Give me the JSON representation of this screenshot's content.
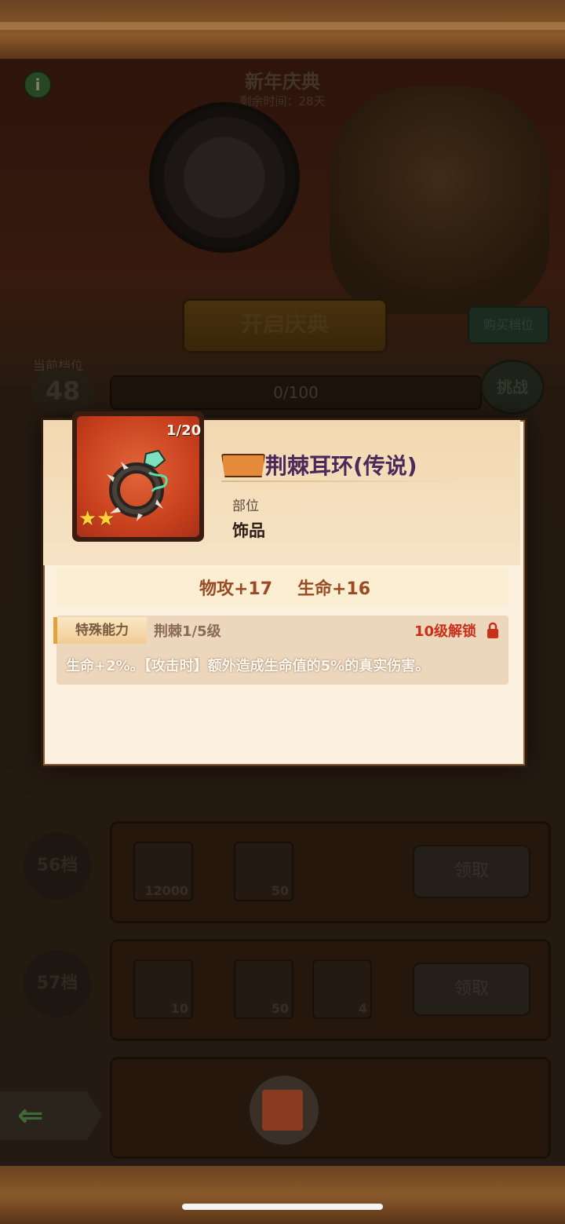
{
  "event": {
    "title": "新年庆典",
    "remaining": "剩余时间：28天",
    "start_button": "开启庆典",
    "buy_button": "购买档位"
  },
  "progress": {
    "current_label": "当前档位",
    "current_value": "48",
    "text": "0/100",
    "challenge_button": "挑战"
  },
  "tiers": [
    {
      "label": "56档",
      "items": [
        "12000",
        "50"
      ],
      "claim": "领取"
    },
    {
      "label": "57档",
      "items": [
        "10",
        "50",
        "4"
      ],
      "claim": "领取"
    }
  ],
  "popup": {
    "count": "1/20",
    "title": "荆棘耳环(传说)",
    "part_label": "部位",
    "part_value": "饰品",
    "stat1": "物攻+17",
    "stat2": "生命+16",
    "ability_tag": "特殊能力",
    "ability_name": "荆棘1/5级",
    "unlock_text": "10级解锁",
    "description": "生命+2%。【攻击时】额外造成生命值的5%的真实伤害。"
  },
  "colors": {
    "rarity": "#e2663a",
    "unlock": "#c8301a",
    "title": "#4a2a5a"
  }
}
